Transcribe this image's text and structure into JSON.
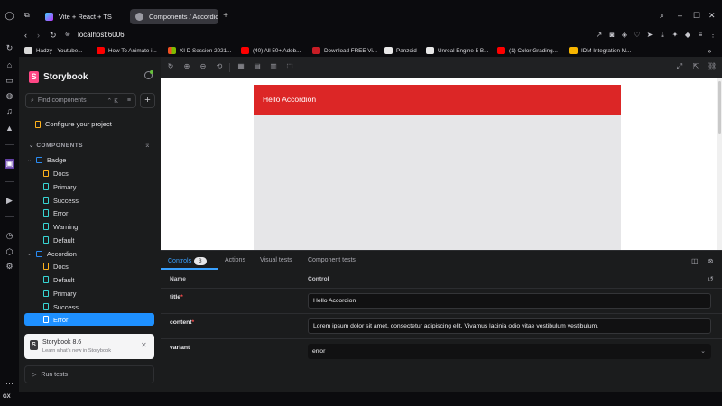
{
  "browser": {
    "tabs": [
      {
        "title": "Vite + React + TS",
        "active": false
      },
      {
        "title": "Components / Accordion",
        "active": true
      }
    ],
    "new_tab": "+",
    "address": "localhost:6006",
    "bookmarks": [
      {
        "label": "Hadzy - Youtube...",
        "color": "#d9d9d9"
      },
      {
        "label": "How To Animate i...",
        "color": "#ff0000"
      },
      {
        "label": "XI D Session 2021...",
        "color": "#2f8bd6"
      },
      {
        "label": "(40) All 50+ Adob...",
        "color": "#ff0000"
      },
      {
        "label": "Download FREE Vi...",
        "color": "#c81d25"
      },
      {
        "label": "Panzoid",
        "color": "#e8e8e8"
      },
      {
        "label": "Unreal Engine 5 B...",
        "color": "#e8e8e8"
      },
      {
        "label": "(1) Color Grading...",
        "color": "#ff0000"
      },
      {
        "label": "IDM Integration M...",
        "color": "#f7b500"
      }
    ],
    "more": "»"
  },
  "sidebar": {
    "title": "Storybook",
    "search_placeholder": "Find components",
    "search_shortcut": "⌃ K",
    "configure": "Configure your project",
    "section": "COMPONENTS",
    "tree": [
      {
        "label": "Badge",
        "kind": "component"
      },
      {
        "label": "Docs",
        "kind": "docs"
      },
      {
        "label": "Primary",
        "kind": "story"
      },
      {
        "label": "Success",
        "kind": "story"
      },
      {
        "label": "Error",
        "kind": "story"
      },
      {
        "label": "Warning",
        "kind": "story"
      },
      {
        "label": "Default",
        "kind": "story"
      },
      {
        "label": "Accordion",
        "kind": "component"
      },
      {
        "label": "Docs",
        "kind": "docs"
      },
      {
        "label": "Default",
        "kind": "story"
      },
      {
        "label": "Primary",
        "kind": "story"
      },
      {
        "label": "Success",
        "kind": "story"
      },
      {
        "label": "Error",
        "kind": "story",
        "selected": true
      }
    ],
    "notice_title": "Storybook 8.6",
    "notice_subtitle": "Learn what's new in Storybook",
    "run_tests": "Run tests"
  },
  "canvas": {
    "accordion_title": "Hello Accordion",
    "header_color": "#dc2626"
  },
  "panel": {
    "tabs": [
      "Controls",
      "Actions",
      "Visual tests",
      "Component tests"
    ],
    "controls_count": "3",
    "columns": [
      "Name",
      "Control"
    ],
    "controls": [
      {
        "name": "title",
        "required": "*",
        "value": "Hello Accordion"
      },
      {
        "name": "content",
        "required": "*",
        "value": "Lorem ipsum dolor sit amet, consectetur adipiscing elit. Vivamus lacinia odio vitae vestibulum vestibulum."
      },
      {
        "name": "variant",
        "required": "",
        "value": "error"
      }
    ]
  },
  "colors": {
    "accent": "#1e90ff",
    "brand": "#ff4785"
  }
}
